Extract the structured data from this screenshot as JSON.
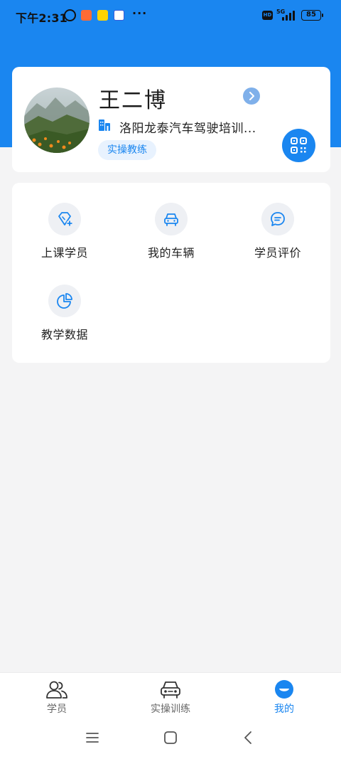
{
  "colors": {
    "brand": "#1a86f0",
    "tag_bg": "#e8f2fe",
    "page_bg": "#f4f4f5",
    "card_bg": "#ffffff"
  },
  "status_bar": {
    "time": "下午2:31",
    "more": "···",
    "hd": "HD",
    "network": "5G",
    "battery": "85"
  },
  "profile": {
    "name": "王二博",
    "school": "洛阳龙泰汽车驾驶培训...",
    "role": "实操教练",
    "icons": {
      "arrow": "chevron-right-icon",
      "school": "building-icon",
      "qr": "qr-code-icon"
    }
  },
  "menu": {
    "items": [
      {
        "label": "上课学员",
        "icon": "diamond-plus-icon"
      },
      {
        "label": "我的车辆",
        "icon": "car-icon"
      },
      {
        "label": "学员评价",
        "icon": "comment-icon"
      },
      {
        "label": "教学数据",
        "icon": "pie-chart-icon"
      }
    ]
  },
  "bottom_nav": {
    "tabs": [
      {
        "label": "学员",
        "icon": "students-icon",
        "active": false
      },
      {
        "label": "实操训练",
        "icon": "car-front-icon",
        "active": false
      },
      {
        "label": "我的",
        "icon": "smile-icon",
        "active": true
      }
    ]
  },
  "system_nav": {
    "icons": [
      "menu-icon",
      "home-icon",
      "back-icon"
    ]
  }
}
